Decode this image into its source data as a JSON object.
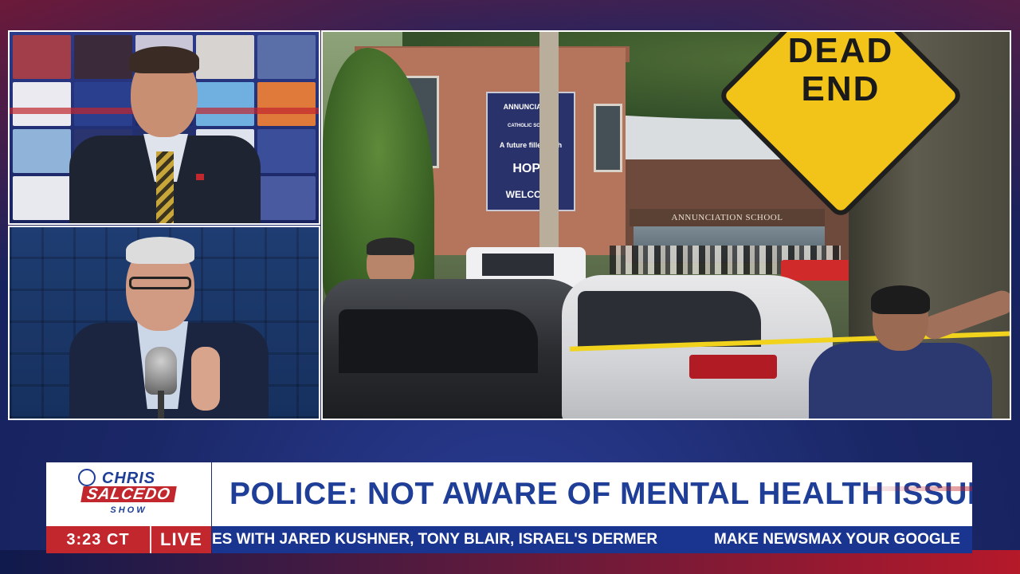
{
  "colors": {
    "brand_blue": "#1f3e97",
    "brand_red": "#c1272d",
    "ticker_blue": "#1a3590",
    "sign_yellow": "#f2c318"
  },
  "host_panel": {
    "icon": "news-anchor"
  },
  "guest_panel": {
    "icon": "guest-with-microphone"
  },
  "scene_panel": {
    "sign_text_line1": "DEAD",
    "sign_text_line2": "END",
    "school_board_line1": "ANNUNCIATION",
    "school_board_line2": "CATHOLIC SCHOOL",
    "school_board_line3": "A future filled with",
    "school_board_line4": "HOPE",
    "school_board_line5": "WELCOME",
    "school_facade": "ANNUNCIATION SCHOOL"
  },
  "logo": {
    "line1": "CHRIS",
    "line2": "SALCEDO",
    "line3": "SHOW"
  },
  "headline": "POLICE: NOT AWARE OF MENTAL HEALTH ISSUE",
  "clock": "3:23 CT",
  "live_label": "LIVE",
  "ticker": {
    "item1": "ES WITH JARED KUSHNER, TONY BLAIR, ISRAEL'S DERMER",
    "item2": "MAKE NEWSMAX YOUR GOOGLE"
  }
}
